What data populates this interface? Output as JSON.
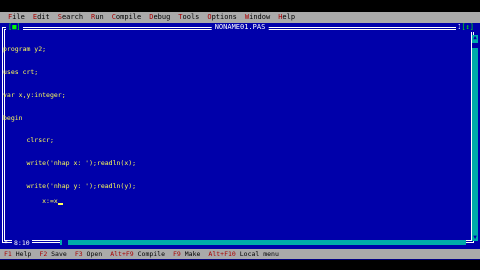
{
  "menu": [
    {
      "hot": "F",
      "rest": "ile"
    },
    {
      "hot": "E",
      "rest": "dit"
    },
    {
      "hot": "S",
      "rest": "earch"
    },
    {
      "hot": "R",
      "rest": "un"
    },
    {
      "hot": "C",
      "rest": "ompile"
    },
    {
      "hot": "D",
      "rest": "ebug"
    },
    {
      "hot": "T",
      "rest": "ools"
    },
    {
      "hot": "O",
      "rest": "ptions"
    },
    {
      "hot": "W",
      "rest": "indow"
    },
    {
      "hot": "H",
      "rest": "elp"
    }
  ],
  "window": {
    "close_box": "[■]",
    "title": "NONAME01.PAS",
    "number": "1",
    "zoom_box": "[↕]",
    "position": "8:10",
    "modified": "*"
  },
  "code_lines": [
    "program y2;",
    "uses crt;",
    "var x,y:integer;",
    "begin",
    "      clrscr;",
    "      write('nhap x: ');readln(x);",
    "      write('nhap y: ');readln(y);",
    "      x:=x"
  ],
  "statusbar": [
    {
      "key": "F1",
      "label": " Help"
    },
    {
      "key": "F2",
      "label": " Save"
    },
    {
      "key": "F3",
      "label": " Open"
    },
    {
      "key": "Alt+F9",
      "label": " Compile"
    },
    {
      "key": "F9",
      "label": " Make"
    },
    {
      "key": "Alt+F10",
      "label": " Local menu"
    }
  ],
  "colors": {
    "editor_bg": "#0000aa",
    "code_text": "#ffff55",
    "menubar_bg": "#aaaaaa",
    "hotkey": "#aa0000"
  }
}
